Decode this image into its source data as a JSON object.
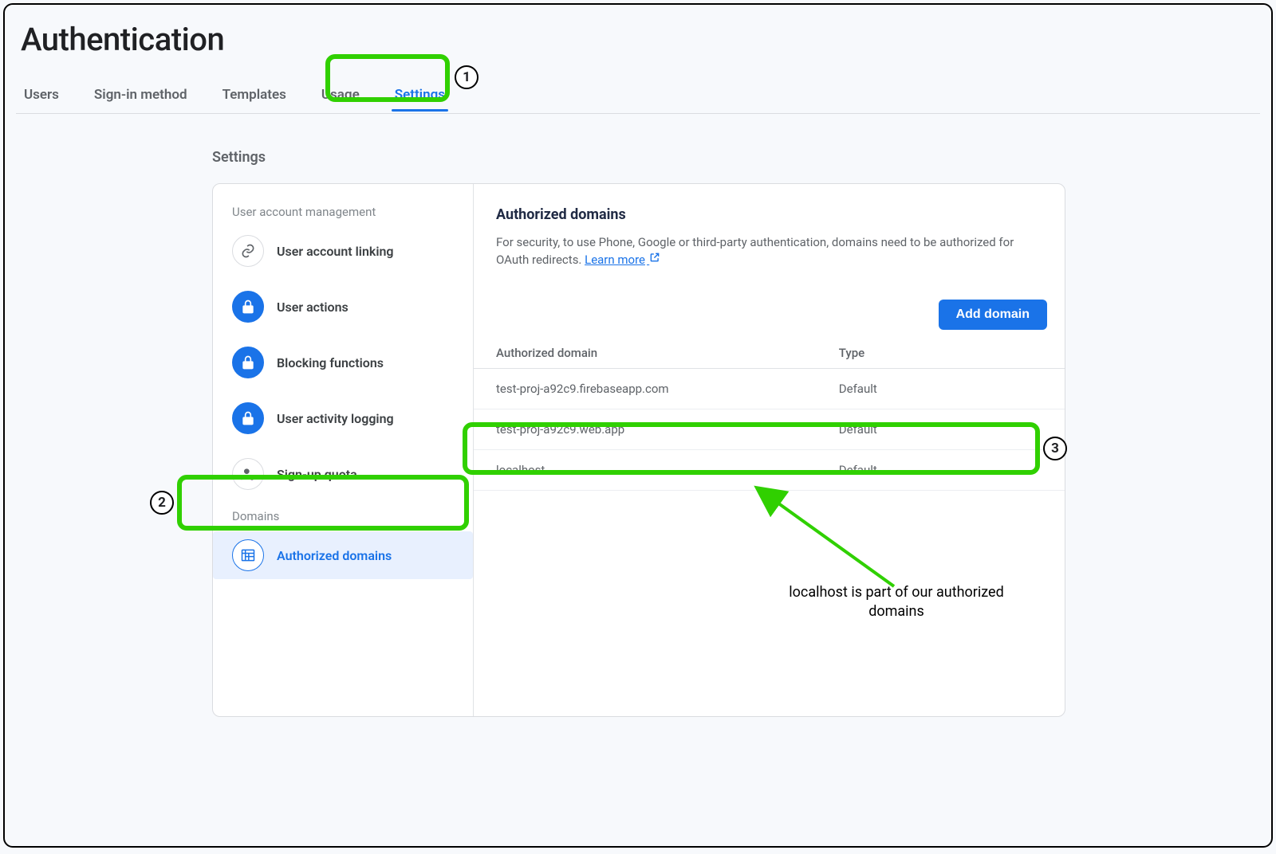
{
  "page_title": "Authentication",
  "tabs": [
    {
      "label": "Users"
    },
    {
      "label": "Sign-in method"
    },
    {
      "label": "Templates"
    },
    {
      "label": "Usage"
    },
    {
      "label": "Settings",
      "active": true
    }
  ],
  "settings_heading": "Settings",
  "sidebar": {
    "group_user": "User account management",
    "group_domains": "Domains",
    "items": [
      {
        "label": "User account linking"
      },
      {
        "label": "User actions"
      },
      {
        "label": "Blocking functions"
      },
      {
        "label": "User activity logging"
      },
      {
        "label": "Sign-up quota"
      },
      {
        "label": "Authorized domains",
        "active": true
      }
    ]
  },
  "panel": {
    "title": "Authorized domains",
    "desc_part1": "For security, to use Phone, Google or third-party authentication, domains need to be authorized for OAuth redirects. ",
    "learn_more": "Learn more",
    "add_button": "Add domain",
    "col_domain": "Authorized domain",
    "col_type": "Type",
    "rows": [
      {
        "domain": "test-proj-a92c9.firebaseapp.com",
        "type": "Default"
      },
      {
        "domain": "test-proj-a92c9.web.app",
        "type": "Default"
      },
      {
        "domain": "localhost",
        "type": "Default"
      }
    ]
  },
  "markers": {
    "m1": "1",
    "m2": "2",
    "m3": "3"
  },
  "annotation_text": "localhost is part of our authorized domains"
}
